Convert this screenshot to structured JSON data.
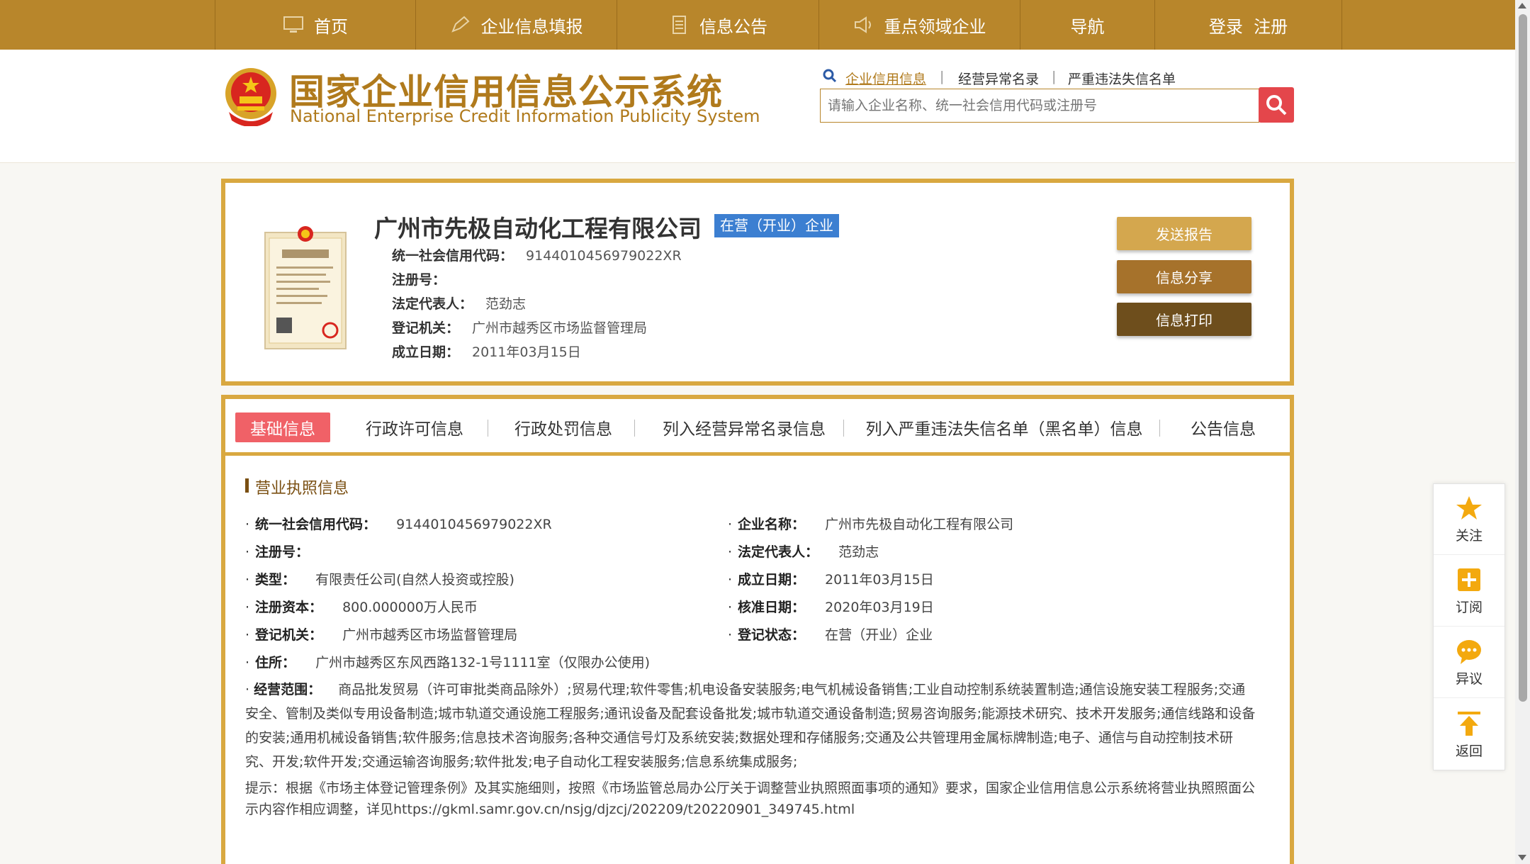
{
  "nav": {
    "items": [
      {
        "label": "首页",
        "icon": "monitor-icon"
      },
      {
        "label": "企业信息填报",
        "icon": "edit-icon"
      },
      {
        "label": "信息公告",
        "icon": "document-icon"
      },
      {
        "label": "重点领域企业",
        "icon": "speaker-icon"
      },
      {
        "label": "导航",
        "icon": ""
      },
      {
        "label": "登录  注册",
        "icon": ""
      }
    ]
  },
  "header": {
    "logo_cn": "国家企业信用信息公示系统",
    "logo_en": "National Enterprise Credit Information Publicity System",
    "search_tabs": [
      "企业信用信息",
      "经营异常名录",
      "严重违法失信名单"
    ],
    "search_placeholder": "请输入企业名称、统一社会信用代码或注册号"
  },
  "company": {
    "name": "广州市先极自动化工程有限公司",
    "status_badge": "在营（开业）企业",
    "fields": [
      {
        "label": "统一社会信用代码：",
        "value": "9144010456979022XR"
      },
      {
        "label": "注册号：",
        "value": ""
      },
      {
        "label": "法定代表人：",
        "value": "范劲志"
      },
      {
        "label": "登记机关：",
        "value": "广州市越秀区市场监督管理局"
      },
      {
        "label": "成立日期：",
        "value": "2011年03月15日"
      }
    ],
    "buttons": [
      "发送报告",
      "信息分享",
      "信息打印"
    ]
  },
  "tabs": [
    "基础信息",
    "行政许可信息",
    "行政处罚信息",
    "列入经营异常名录信息",
    "列入严重违法失信名单（黑名单）信息",
    "公告信息"
  ],
  "section": {
    "title": "营业执照信息",
    "left": [
      {
        "label": "统一社会信用代码：",
        "value": "9144010456979022XR"
      },
      {
        "label": "注册号：",
        "value": ""
      },
      {
        "label": "类型：",
        "value": "有限责任公司(自然人投资或控股)"
      },
      {
        "label": "注册资本：",
        "value": "800.000000万人民币"
      },
      {
        "label": "登记机关：",
        "value": "广州市越秀区市场监督管理局"
      },
      {
        "label": "住所：",
        "value": "广州市越秀区东风西路132-1号1111室（仅限办公使用)"
      }
    ],
    "right": [
      {
        "label": "企业名称：",
        "value": "广州市先极自动化工程有限公司"
      },
      {
        "label": "法定代表人：",
        "value": "范劲志"
      },
      {
        "label": "成立日期：",
        "value": "2011年03月15日"
      },
      {
        "label": "核准日期：",
        "value": "2020年03月19日"
      },
      {
        "label": "登记状态：",
        "value": "在营（开业）企业"
      }
    ],
    "scope_label": "经营范围：",
    "scope_value": "商品批发贸易（许可审批类商品除外）;贸易代理;软件零售;机电设备安装服务;电气机械设备销售;工业自动控制系统装置制造;通信设施安装工程服务;交通安全、管制及类似专用设备制造;城市轨道交通设施工程服务;通讯设备及配套设备批发;城市轨道交通设备制造;贸易咨询服务;能源技术研究、技术开发服务;通信线路和设备的安装;通用机械设备销售;软件服务;信息技术咨询服务;各种交通信号灯及系统安装;数据处理和存储服务;交通及公共管理用金属标牌制造;电子、通信与自动控制技术研究、开发;软件开发;交通运输咨询服务;软件批发;电子自动化工程安装服务;信息系统集成服务;",
    "tip": "提示：根据《市场主体登记管理条例》及其实施细则，按照《市场监管总局办公厅关于调整营业执照照面事项的通知》要求，国家企业信用信息公示系统将营业执照照面公示内容作相应调整，详见https://gkml.samr.gov.cn/nsjg/djzcj/202209/t20220901_349745.html"
  },
  "sidebar": [
    {
      "label": "关注",
      "icon": "star-icon"
    },
    {
      "label": "订阅",
      "icon": "plus-icon"
    },
    {
      "label": "异议",
      "icon": "chat-icon"
    },
    {
      "label": "返回",
      "icon": "arrow-up-icon"
    }
  ],
  "colors": {
    "nav": "#b8862b",
    "panel_border": "#d9a840",
    "active_tab": "#f06167",
    "badge": "#3c7fd1",
    "search_btn": "#e4464b"
  }
}
